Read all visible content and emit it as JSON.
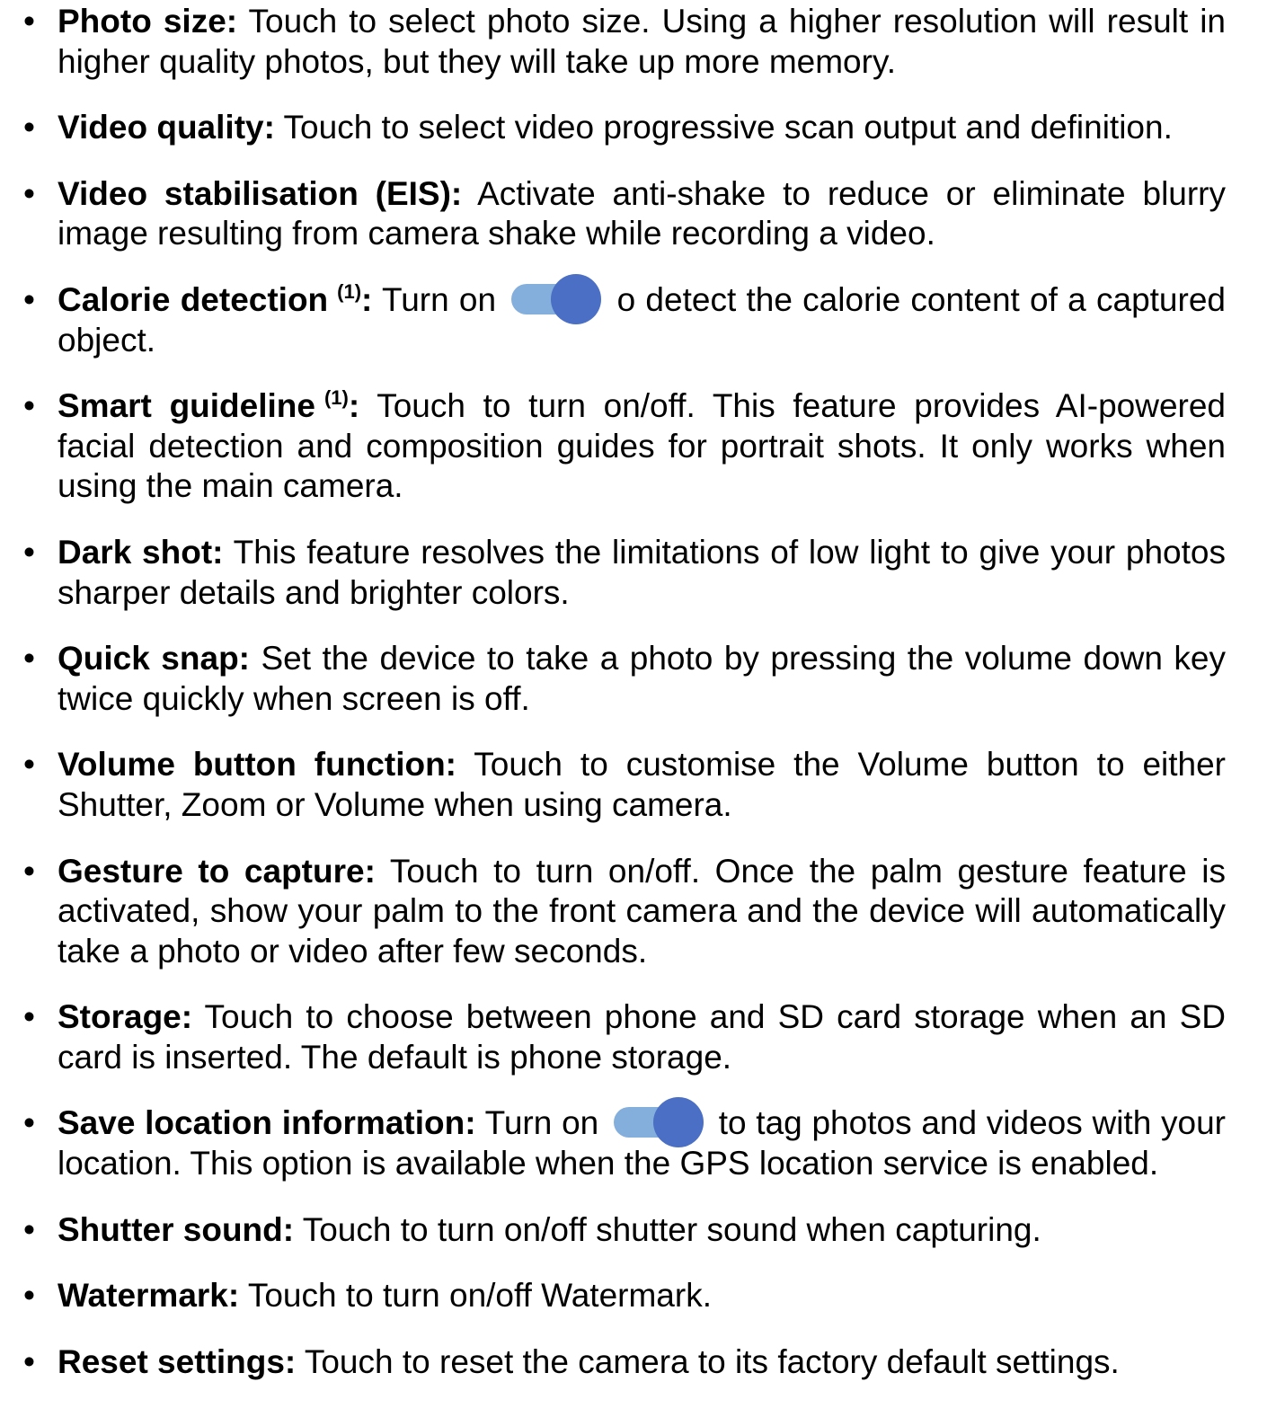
{
  "colors": {
    "text": "#000000",
    "toggle_track": "#84aedc",
    "toggle_knob": "#4a6fc4"
  },
  "items": [
    {
      "term": "Photo size:",
      "text": " Touch to select photo size. Using a higher resolution will result in higher quality photos, but they will take up more memory."
    },
    {
      "term": "Video quality:",
      "text": " Touch to select video progressive scan output and definition."
    },
    {
      "term": "Video stabilisation (EIS):",
      "text": " Activate anti-shake to reduce or eliminate blurry image resulting from camera shake while recording a video."
    },
    {
      "term": "Calorie detection",
      "note": "(1)",
      "colon": ":",
      "text_before_toggle": " Turn on ",
      "toggle_icon": "toggle-switch-on-icon",
      "text_after_toggle": " o detect the calorie content of a captured object."
    },
    {
      "term": "Smart guideline",
      "note": "(1)",
      "colon": ":",
      "text": " Touch to turn on/off. This feature provides AI-powered facial detection and composition guides for portrait shots. It only works when using the main camera."
    },
    {
      "term": "Dark shot:",
      "text": " This feature resolves the limitations of low light  to give your photos sharper details and brighter colors."
    },
    {
      "term": "Quick snap:",
      "text": " Set the device to take a photo by pressing the volume down key twice quickly when screen is off."
    },
    {
      "term": "Volume button function:",
      "text": " Touch to customise the Volume button to either Shutter, Zoom or Volume when using camera."
    },
    {
      "term": "Gesture to capture:",
      "text": " Touch to turn on/off. Once the palm gesture feature is activated, show your palm to the front camera and the device will automatically take a photo or video after few seconds."
    },
    {
      "term": "Storage:",
      "text": " Touch to choose between phone and SD card storage when an SD card is inserted. The default is phone storage."
    },
    {
      "term": "Save location information:",
      "text_before_toggle": " Turn on ",
      "toggle_icon": "toggle-switch-on-icon",
      "text_after_toggle": " to tag photos and videos with your location. This option is available when the GPS location service is enabled."
    },
    {
      "term": "Shutter sound:",
      "text": " Touch to turn on/off shutter sound when capturing."
    },
    {
      "term": "Watermark:",
      "text": " Touch to turn on/off Watermark."
    },
    {
      "term": "Reset settings:",
      "text": " Touch to reset the camera to its factory default settings."
    }
  ]
}
